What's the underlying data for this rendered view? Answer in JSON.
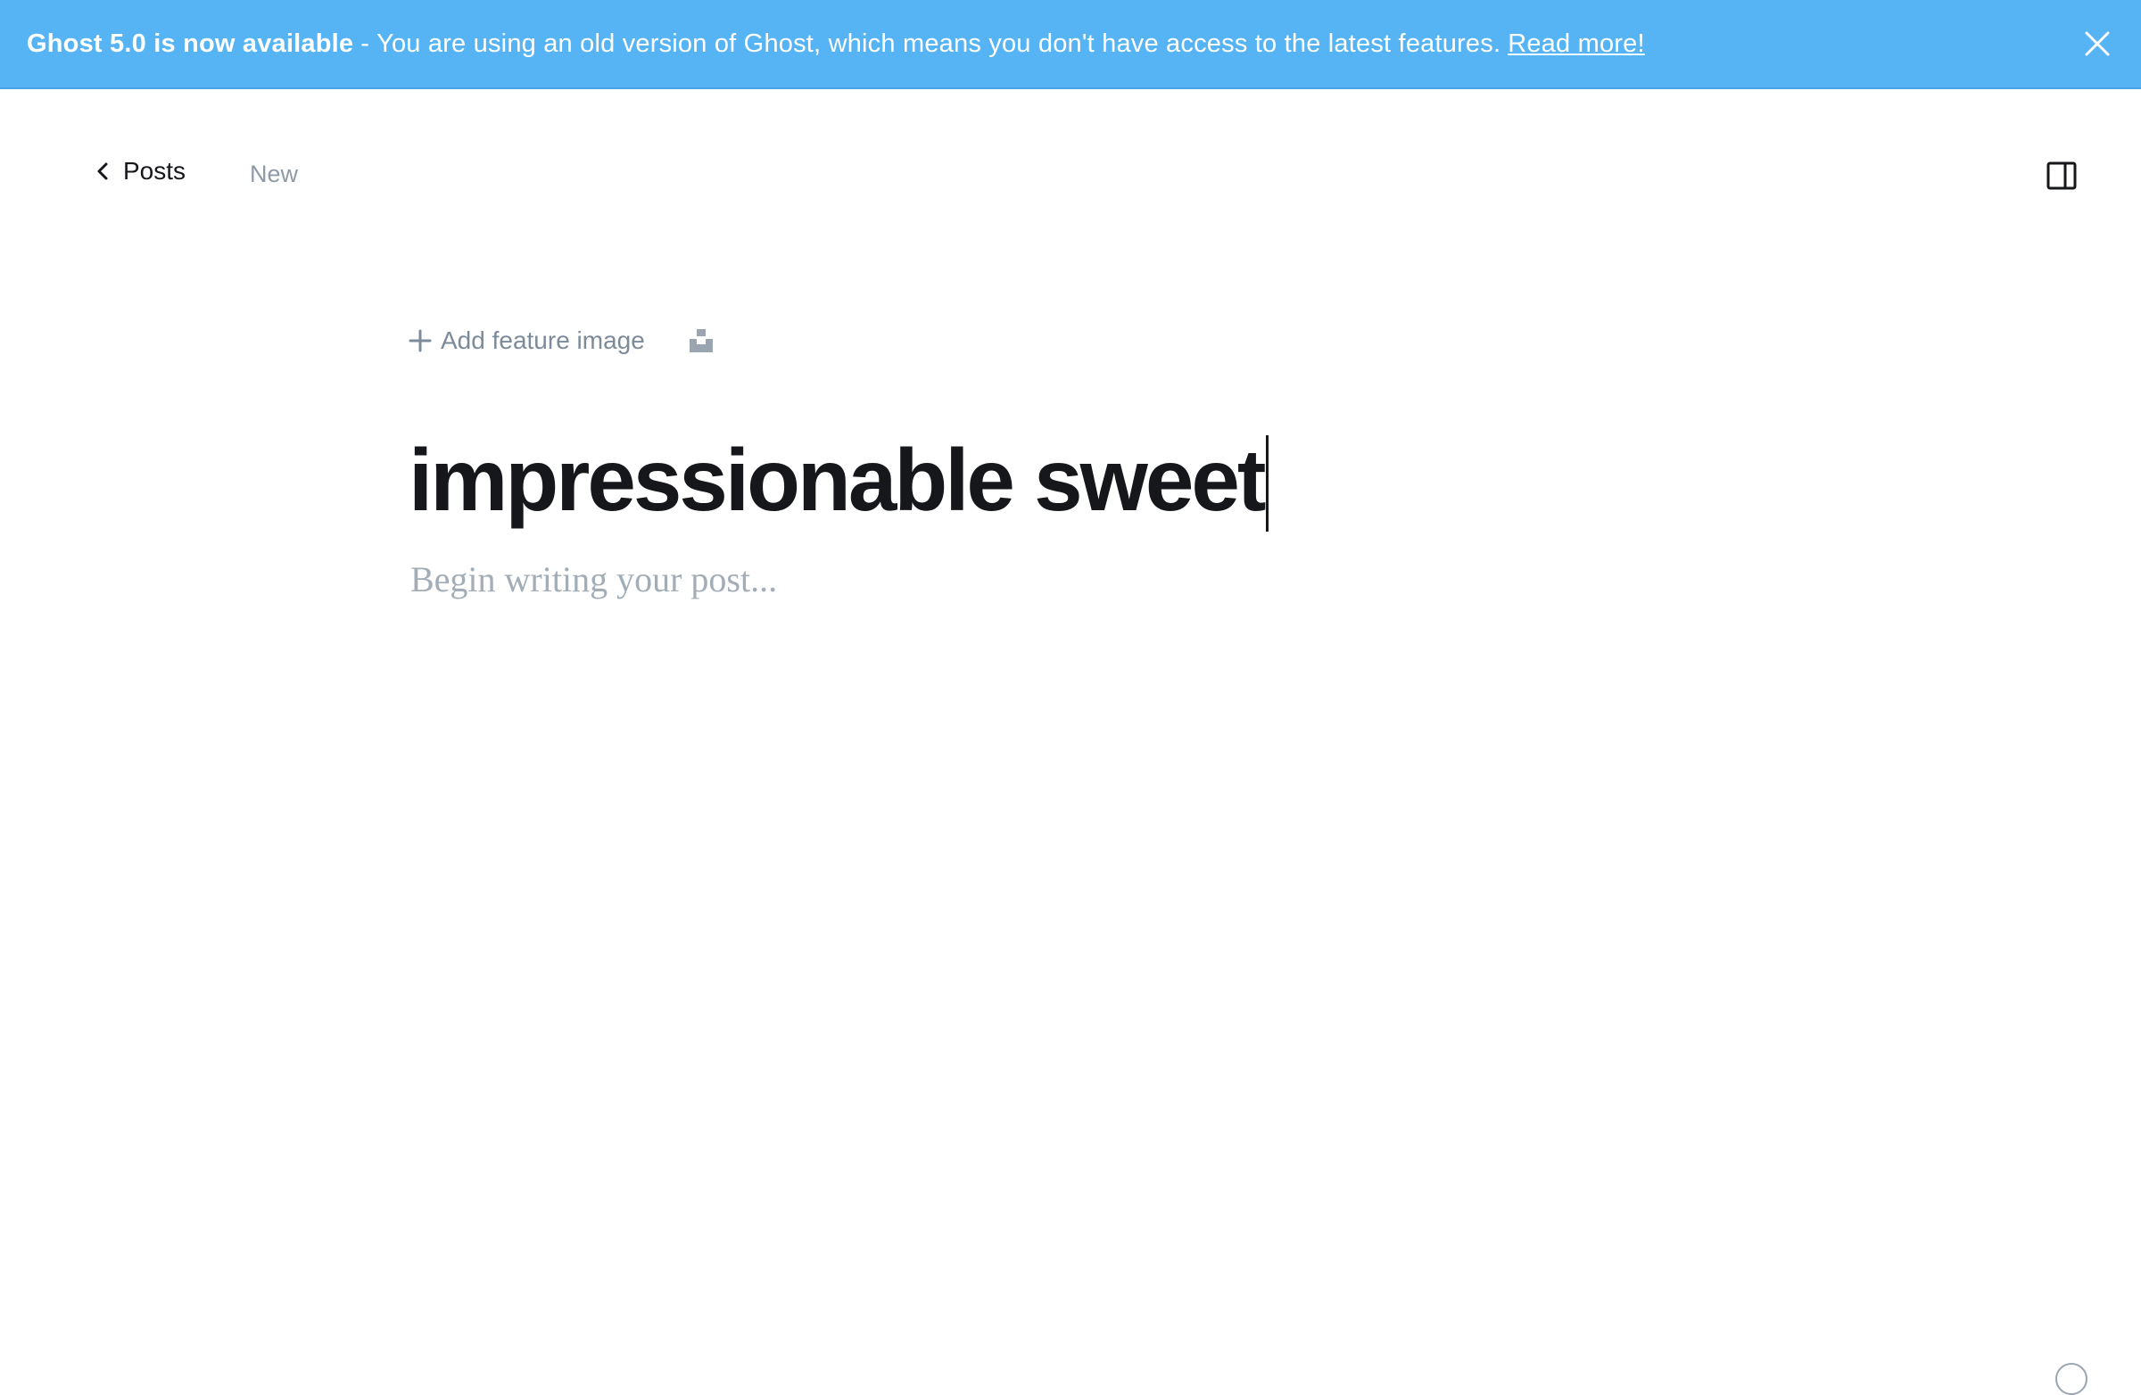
{
  "banner": {
    "title": "Ghost 5.0 is now available",
    "separator": "-",
    "message": "You are using an old version of Ghost, which means you don't have access to the latest features.",
    "link_label": "Read more!",
    "close_icon": "close-icon",
    "bg_color": "#56b4f5"
  },
  "header": {
    "back_label": "Posts",
    "back_icon": "chevron-left-icon",
    "status": "New",
    "sidebar_icon": "sidebar-toggle-icon"
  },
  "feature": {
    "add_label": "Add feature image",
    "add_icon": "plus-icon",
    "unsplash_icon": "unsplash-icon"
  },
  "post": {
    "title": "impressionable sweet",
    "body_placeholder": "Begin writing your post..."
  },
  "footer": {
    "help_icon": "help-icon"
  }
}
